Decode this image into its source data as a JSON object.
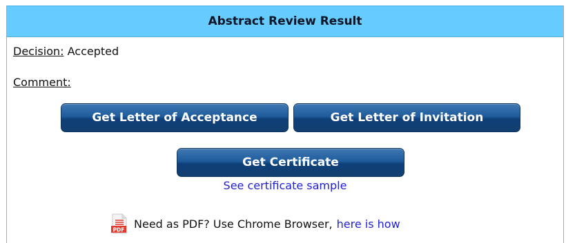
{
  "header": {
    "title": "Abstract Review Result"
  },
  "decision": {
    "label": "Decision:",
    "value": "Accepted"
  },
  "comment": {
    "label": "Comment:"
  },
  "buttons": {
    "acceptance": "Get Letter of Acceptance",
    "invitation": "Get Letter of Invitation",
    "certificate": "Get Certificate"
  },
  "links": {
    "sample": "See certificate sample",
    "how": "here is how"
  },
  "pdf_note": {
    "icon_label": "PDF",
    "text": "Need as PDF? Use Chrome Browser,"
  },
  "colors": {
    "header_bg": "#66ccff",
    "button_bg": "#1f5c9c",
    "link": "#1f1fd8",
    "pdf_icon": "#e23b2e"
  }
}
